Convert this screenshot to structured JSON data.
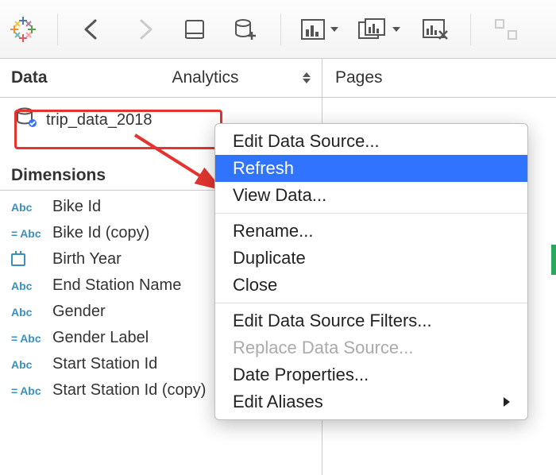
{
  "toolbar": {
    "icons": [
      "logo",
      "back",
      "forward",
      "save",
      "new-datasource",
      "new-worksheet",
      "duplicate-sheet",
      "clear-sheet",
      "swap"
    ]
  },
  "tabs": {
    "data": "Data",
    "analytics": "Analytics"
  },
  "datasource": {
    "name": "trip_data_2018"
  },
  "dimensions": {
    "header": "Dimensions",
    "fields": [
      {
        "type": "Abc",
        "calc": false,
        "label": "Bike Id"
      },
      {
        "type": "Abc",
        "calc": true,
        "label": "Bike Id (copy)"
      },
      {
        "type": "date",
        "calc": false,
        "label": "Birth Year"
      },
      {
        "type": "Abc",
        "calc": false,
        "label": "End Station Name"
      },
      {
        "type": "Abc",
        "calc": false,
        "label": "Gender"
      },
      {
        "type": "Abc",
        "calc": true,
        "label": "Gender Label"
      },
      {
        "type": "Abc",
        "calc": false,
        "label": "Start Station Id"
      },
      {
        "type": "Abc",
        "calc": true,
        "label": "Start Station Id (copy)"
      }
    ]
  },
  "pages": {
    "header": "Pages"
  },
  "context_menu": {
    "items": [
      {
        "label": "Edit Data Source...",
        "state": "normal"
      },
      {
        "label": "Refresh",
        "state": "highlighted"
      },
      {
        "label": "View Data...",
        "state": "normal"
      },
      {
        "sep": true
      },
      {
        "label": "Rename...",
        "state": "normal"
      },
      {
        "label": "Duplicate",
        "state": "normal"
      },
      {
        "label": "Close",
        "state": "normal"
      },
      {
        "sep": true
      },
      {
        "label": "Edit Data Source Filters...",
        "state": "normal"
      },
      {
        "label": "Replace Data Source...",
        "state": "disabled"
      },
      {
        "label": "Date Properties...",
        "state": "normal"
      },
      {
        "label": "Edit Aliases",
        "state": "normal",
        "submenu": true
      }
    ]
  }
}
